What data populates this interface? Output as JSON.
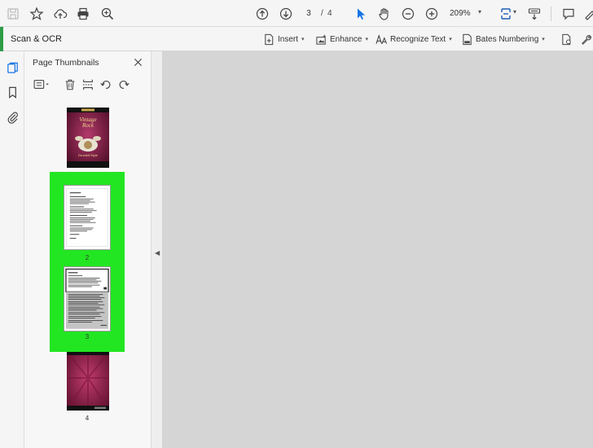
{
  "toolbar": {
    "current_page": "3",
    "page_separator": "/",
    "total_pages": "4",
    "zoom": "209%"
  },
  "tools_bar": {
    "title": "Scan & OCR",
    "items": [
      {
        "label": "Insert",
        "icon": "insert-page-icon"
      },
      {
        "label": "Enhance",
        "icon": "enhance-icon"
      },
      {
        "label": "Recognize Text",
        "icon": "recognize-text-icon"
      },
      {
        "label": "Bates Numbering",
        "icon": "bates-numbering-icon"
      }
    ]
  },
  "nav_rail": {
    "icons": [
      "page-thumbnails-icon",
      "bookmark-icon",
      "attachment-icon"
    ]
  },
  "thumbnails_panel": {
    "title": "Page Thumbnails",
    "pages": [
      {
        "label": "",
        "kind": "cover"
      },
      {
        "label": "2",
        "kind": "text",
        "selected": true
      },
      {
        "label": "3",
        "kind": "text-grey",
        "selected": true
      },
      {
        "label": "4",
        "kind": "back-cover"
      }
    ],
    "selection_color": "#22e622"
  },
  "colors": {
    "accent_green": "#2e9c47",
    "cursor_blue": "#1473e6"
  }
}
